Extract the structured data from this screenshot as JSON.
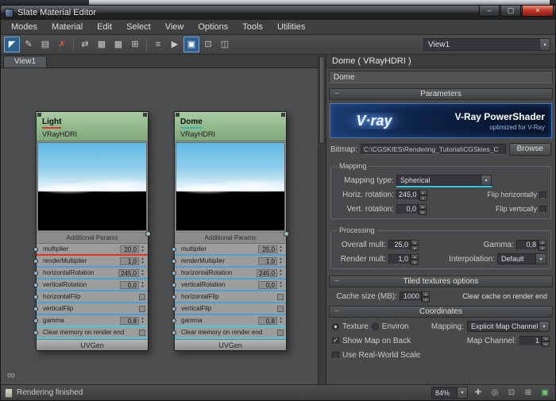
{
  "window": {
    "title": "Slate Material Editor",
    "controls": {
      "minimize": "–",
      "maximize": "▢",
      "close": "×"
    }
  },
  "menu": {
    "items": [
      "Modes",
      "Material",
      "Edit",
      "Select",
      "View",
      "Options",
      "Tools",
      "Utilities"
    ]
  },
  "toolbar": {
    "view_selector": "View1",
    "icons": [
      {
        "name": "select-tool",
        "glyph": "◤"
      },
      {
        "name": "pick-material-from-object",
        "glyph": "✎"
      },
      {
        "name": "put-to-library",
        "glyph": "▤"
      },
      {
        "name": "delete-selected",
        "glyph": "✗"
      },
      {
        "name": "move-children",
        "glyph": "⇄"
      },
      {
        "name": "hide-unused-nodeslots",
        "glyph": "▦"
      },
      {
        "name": "show-grid",
        "glyph": "▩"
      },
      {
        "name": "snap-to-grid",
        "glyph": "⊞"
      },
      {
        "name": "align-nodes",
        "glyph": "≡"
      },
      {
        "name": "arrange-children",
        "glyph": "▶"
      },
      {
        "name": "layout-all",
        "glyph": "▣"
      },
      {
        "name": "zoom-extents",
        "glyph": "⊡"
      },
      {
        "name": "material-preview-window",
        "glyph": "◫"
      }
    ]
  },
  "node_view": {
    "tab": "View1",
    "nodes": [
      {
        "title": "Light",
        "type": "VRayHDRI",
        "underline": "#d23b2e",
        "section": "Additional Params",
        "footer": "UVGen",
        "rows": [
          {
            "label": "multiplier",
            "value": "20,0",
            "color": "#e03222"
          },
          {
            "label": "renderMultiplier",
            "value": "1,0",
            "color": "#4a9fd8"
          },
          {
            "label": "horizontalRotation",
            "value": "245,0",
            "color": "#4a9fd8"
          },
          {
            "label": "verticalRotation",
            "value": "0,0",
            "color": "#4a9fd8"
          },
          {
            "label": "horizontalFlip",
            "color": "#4a9fd8"
          },
          {
            "label": "verticalFlip",
            "color": "#4a9fd8"
          },
          {
            "label": "gamma",
            "value": "0,8",
            "color": "#45c8e0"
          },
          {
            "label": "Clear memory on render end",
            "color": "#45c8e0"
          }
        ]
      },
      {
        "title": "Dome",
        "type": "VRayHDRI",
        "underline": "#3fb3a8",
        "section": "Additional Params",
        "footer": "UVGen",
        "rows": [
          {
            "label": "multiplier",
            "value": "25,0",
            "color": "#4a9fd8"
          },
          {
            "label": "renderMultiplier",
            "value": "1,0",
            "color": "#4a9fd8"
          },
          {
            "label": "horizontalRotation",
            "value": "245,0",
            "color": "#4a9fd8"
          },
          {
            "label": "verticalRotation",
            "value": "0,0",
            "color": "#4a9fd8"
          },
          {
            "label": "horizontalFlip",
            "color": "#4a9fd8"
          },
          {
            "label": "verticalFlip",
            "color": "#4a9fd8"
          },
          {
            "label": "gamma",
            "value": "0,8",
            "color": "#45c8e0"
          },
          {
            "label": "Clear memory on render end",
            "color": "#45c8e0"
          }
        ]
      }
    ]
  },
  "inspector": {
    "header": "Dome  ( VRayHDRI )",
    "name": "Dome",
    "parameters_rollout": "Parameters",
    "banner": {
      "logo": "V·ray",
      "title": "V-Ray PowerShader",
      "subtitle": "optimized for V-Ray"
    },
    "bitmap": {
      "label": "Bitmap:",
      "path": "C:\\CGSKIES\\Rendering_Tutorial\\CGSkies_C",
      "browse": "Browse"
    },
    "mapping": {
      "title": "Mapping",
      "type_label": "Mapping type:",
      "type_value": "Spherical",
      "horiz_label": "Horiz. rotation:",
      "horiz_value": "245,0",
      "flip_h_label": "Flip horizontally",
      "vert_label": "Vert. rotation:",
      "vert_value": "0,0",
      "flip_v_label": "Flip vertically"
    },
    "processing": {
      "title": "Processing",
      "overall_label": "Overall mult:",
      "overall_value": "25,0",
      "gamma_label": "Gamma:",
      "gamma_value": "0,8",
      "render_label": "Render mult:",
      "render_value": "1,0",
      "interp_label": "Interpolation:",
      "interp_value": "Default"
    },
    "tiled": {
      "rollout": "Tiled textures options",
      "cache_label": "Cache size (MB):",
      "cache_value": "1000",
      "clear_label": "Clear cache on render end"
    },
    "coordinates": {
      "rollout": "Coordinates",
      "texture_label": "Texture",
      "environ_label": "Environ",
      "mapping_label": "Mapping:",
      "mapping_value": "Explicit Map Channel",
      "show_map_label": "Show Map on Back",
      "map_channel_label": "Map Channel:",
      "map_channel_value": "1",
      "real_world_label": "Use Real-World Scale"
    }
  },
  "status_bar": {
    "message": "Rendering finished",
    "zoom": "84%",
    "icons": [
      {
        "name": "pan-tool",
        "glyph": "✚"
      },
      {
        "name": "zoom-tool",
        "glyph": "◎"
      },
      {
        "name": "zoom-region-tool",
        "glyph": "⊡"
      },
      {
        "name": "zoom-extents",
        "glyph": "⊞"
      },
      {
        "name": "zoom-extents-selected",
        "glyph": "▣"
      }
    ]
  }
}
